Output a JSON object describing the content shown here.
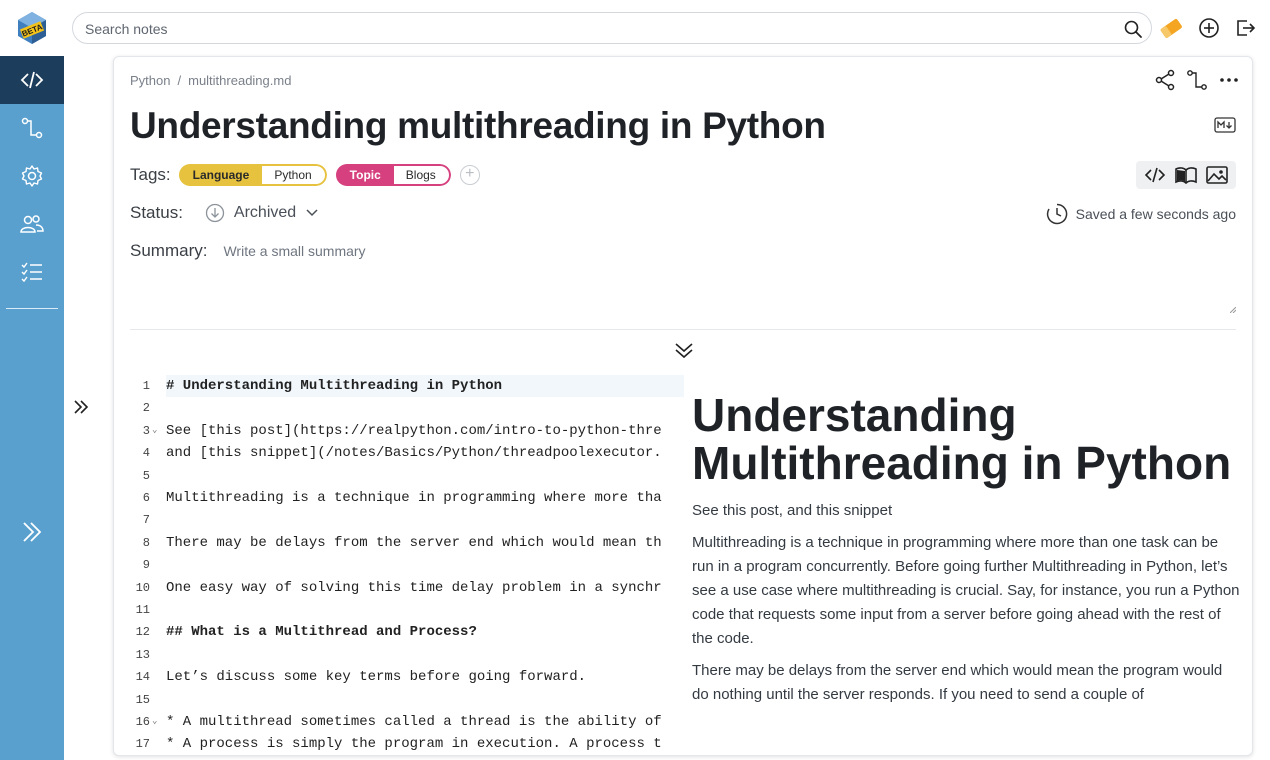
{
  "app": {
    "logo_text": "BETA",
    "search_placeholder": "Search notes"
  },
  "sidebar": {
    "items": [
      "code-editor",
      "graph",
      "settings",
      "users",
      "checklist"
    ],
    "active": "code-editor"
  },
  "note": {
    "breadcrumb": [
      "Python",
      "multithreading.md"
    ],
    "title": "Understanding multithreading in Python",
    "tags_label": "Tags:",
    "tags": [
      {
        "key": "Language",
        "value": "Python",
        "color": "#e6c23e"
      },
      {
        "key": "Topic",
        "value": "Blogs",
        "color": "#d6407e"
      }
    ],
    "status_label": "Status:",
    "status_value": "Archived",
    "saved_text": "Saved a few seconds ago",
    "summary_label": "Summary:",
    "summary_placeholder": "Write a small summary"
  },
  "editor": {
    "lines": [
      {
        "n": "1",
        "text": "# Understanding Multithreading in Python",
        "bold": true,
        "hl": true
      },
      {
        "n": "2",
        "text": ""
      },
      {
        "n": "3",
        "text": "See [this post](https://realpython.com/intro-to-python-thre",
        "fold": true
      },
      {
        "n": "4",
        "text": "and [this snippet](/notes/Basics/Python/threadpoolexecutor."
      },
      {
        "n": "5",
        "text": ""
      },
      {
        "n": "6",
        "text": "Multithreading is a technique in programming where more tha"
      },
      {
        "n": "7",
        "text": ""
      },
      {
        "n": "8",
        "text": "There may be delays from the server end which would mean th"
      },
      {
        "n": "9",
        "text": ""
      },
      {
        "n": "10",
        "text": "One easy way of solving this time delay problem in a synchr"
      },
      {
        "n": "11",
        "text": ""
      },
      {
        "n": "12",
        "text": "## What is a Multithread and Process?",
        "bold": true
      },
      {
        "n": "13",
        "text": ""
      },
      {
        "n": "14",
        "text": "Let’s discuss some key terms before going forward."
      },
      {
        "n": "15",
        "text": ""
      },
      {
        "n": "16",
        "text": "* A multithread sometimes called a thread is the ability of",
        "fold": true
      },
      {
        "n": "17",
        "text": "* A process is simply the program in execution. A process t"
      }
    ]
  },
  "preview": {
    "h1": "Understanding Multithreading in Python",
    "p1": "See this post, and this snippet",
    "p2": "Multithreading is a technique in programming where more than one task can be run in a program concurrently. Before going further Multithreading in Python, let’s see a use case where multithreading is crucial. Say, for instance, you run a Python code that requests some input from a server before going ahead with the rest of the code.",
    "p3": "There may be delays from the server end which would mean the program would do nothing until the server responds. If you need to send a couple of"
  }
}
